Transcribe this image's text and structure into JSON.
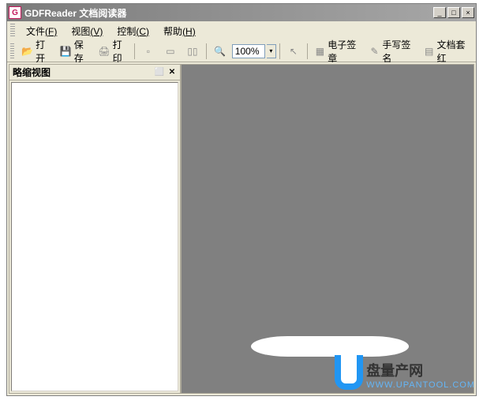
{
  "title": "GDFReader  文档阅读器",
  "menu": {
    "file": {
      "label": "文件",
      "accel": "(F)"
    },
    "view": {
      "label": "视图",
      "accel": "(V)"
    },
    "control": {
      "label": "控制",
      "accel": "(C)"
    },
    "help": {
      "label": "帮助",
      "accel": "(H)"
    }
  },
  "toolbar": {
    "open": "打开",
    "save": "保存",
    "print": "打印",
    "zoom": "100%",
    "esign": "电子签章",
    "handwrite": "手写签名",
    "doctpl": "文档套红"
  },
  "sidepanel": {
    "title": "略缩视图"
  },
  "watermark": {
    "top": "盘量产网",
    "bot": "WWW.UPANTOOL.COM"
  },
  "icons": {
    "logo": "G",
    "minimize": "_",
    "maximize": "□",
    "close": "×",
    "pin": "⬜",
    "x": "✕",
    "dd": "▾"
  }
}
